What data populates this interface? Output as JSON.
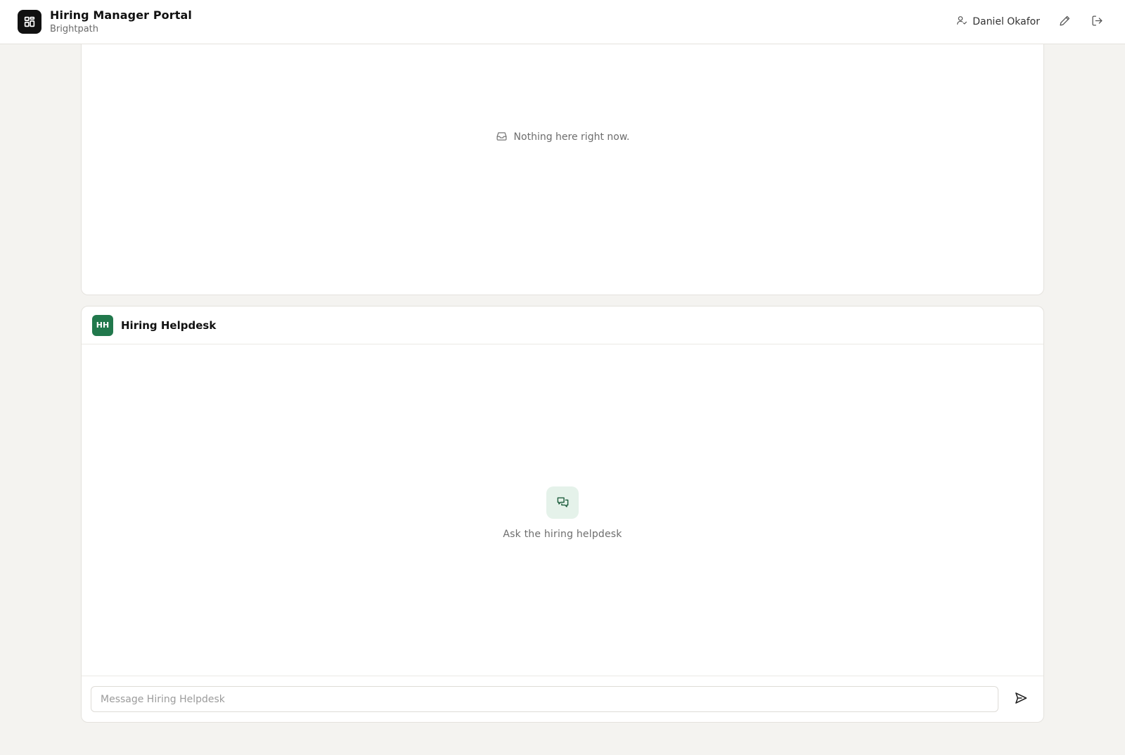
{
  "header": {
    "title": "Hiring Manager Portal",
    "subtitle": "Brightpath",
    "logo_icon": "dashboard-grid-icon",
    "user_name": "Daniel Okafor",
    "user_icon": "user-check-icon",
    "edit_icon": "pencil-icon",
    "logout_icon": "logout-icon"
  },
  "top_panel": {
    "empty_message": "Nothing here right now.",
    "empty_icon": "inbox-icon"
  },
  "chat": {
    "avatar_initials": "HH",
    "title": "Hiring Helpdesk",
    "empty_icon": "chat-bubbles-icon",
    "empty_message": "Ask the hiring helpdesk",
    "input_placeholder": "Message Hiring Helpdesk",
    "input_value": "",
    "send_icon": "send-icon"
  },
  "colors": {
    "background": "#f4f3f0",
    "accent_green": "#21784c",
    "accent_green_light": "#e5f2ea",
    "logo_bg": "#111111"
  }
}
